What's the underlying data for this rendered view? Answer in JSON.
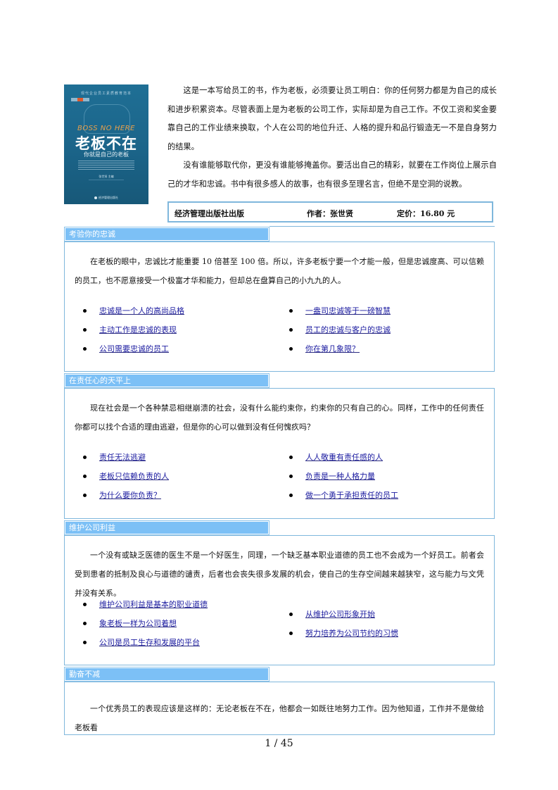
{
  "book": {
    "cover": {
      "series": "现代企业员工素质教育范本",
      "tagline": "BOSS NO HERE",
      "title": "老板不在",
      "subtitle": "你就是自己的老板",
      "author_line": "张世贤 主编",
      "publisher_mark": "经济管理出版社"
    },
    "intro_paragraphs": [
      "这是一本写给员工的书，作为老板，必须要让员工明白：你的任何努力都是为自己的成长和进步积累资本。尽管表面上是为老板的公司工作，实际却是为自己工作。不仅工资和奖金要靠自己的工作业绩来换取，个人在公司的地位升迁、人格的提升和品行锻造无一不是自身努力的结果。",
      "没有谁能够取代你，更没有谁能够掩盖你。要活出自己的精彩，就要在工作岗位上展示自己的才华和忠诚。书中有很多感人的故事，也有很多至理名言，但绝不是空洞的说教。"
    ],
    "publisher": "经济管理出版社出版",
    "author": "作者：张世贤",
    "price": "定价：16.80 元"
  },
  "sections": [
    {
      "title": "考验你的忠诚",
      "text": "在老板的眼中，忠诚比才能重要 10 倍甚至 100 倍。所以，许多老板宁要一个才能一般，但是忠诚度高、可以信赖的员工，也不愿意接受一个极富才华和能力，但却总在盘算自己的小九九的人。",
      "left_links": [
        "忠诚是一个人的高尚品格",
        "主动工作是忠诚的表现",
        "公司需要忠诚的员工"
      ],
      "right_links": [
        "一盎司忠诚等于一磅智慧",
        "员工的忠诚与客户的忠诚",
        "你在第几象限？"
      ]
    },
    {
      "title": "在责任心的天平上",
      "text": "现在社会是一个各种禁忌相继崩溃的社会，没有什么能约束你，约束你的只有自己的心。同样，工作中的任何责任你都可以找个合适的理由逃避，但是你的心可以做到没有任何愧疚吗？",
      "left_links": [
        "责任无法逃避",
        "老板只信赖负责的人",
        "为什么要你负责？"
      ],
      "right_links": [
        "人人敬重有责任感的人",
        "负责是一种人格力量",
        "做一个勇于承担责任的员工"
      ]
    },
    {
      "title": "维护公司利益",
      "text": "一个没有或缺乏医德的医生不是一个好医生，同理，一个缺乏基本职业道德的员工也不会成为一个好员工。前者会受到患者的抵制及良心与道德的谴责，后者也会丧失很多发展的机会，使自己的生存空间越来越狭窄，这与能力与文凭并没有关系。",
      "left_links": [
        "维护公司利益是基本的职业道德",
        "象老板一样为公司着想",
        "公司是员工生存和发展的平台"
      ],
      "right_links": [
        "从维护公司形象开始",
        "努力培养为公司节约的习惯"
      ]
    },
    {
      "title": "勤奋不减",
      "text": "一个优秀员工的表现应该是这样的：无论老板在不在，他都会一如既往地努力工作。因为他知道，工作并不是做给老板看",
      "left_links": [],
      "right_links": []
    }
  ],
  "footer": {
    "page_number": "1 / 45"
  },
  "colors": {
    "section_tab": "#7cc0f6",
    "box_border": "#7fb7dc",
    "link": "#1b1ba0"
  }
}
